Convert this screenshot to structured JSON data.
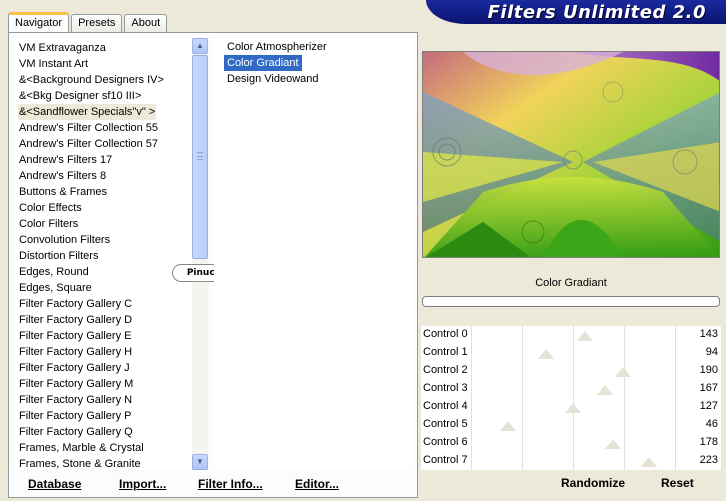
{
  "tabs": [
    {
      "label": "Navigator"
    },
    {
      "label": "Presets"
    },
    {
      "label": "About"
    }
  ],
  "app_title": "Filters Unlimited 2.0",
  "categories": [
    "VM Extravaganza",
    "VM Instant Art",
    "&<Background Designers IV>",
    "&<Bkg Designer sf10 III>",
    "&<Sandflower Specials\"v\" >",
    "Andrew's Filter Collection 55",
    "Andrew's Filter Collection 57",
    "Andrew's Filters 17",
    "Andrew's Filters 8",
    "Buttons & Frames",
    "Color Effects",
    "Color Filters",
    "Convolution Filters",
    "Distortion Filters",
    "Edges, Round",
    "Edges, Square",
    "Filter Factory Gallery C",
    "Filter Factory Gallery D",
    "Filter Factory Gallery E",
    "Filter Factory Gallery H",
    "Filter Factory Gallery J",
    "Filter Factory Gallery M",
    "Filter Factory Gallery N",
    "Filter Factory Gallery P",
    "Filter Factory Gallery Q",
    "Frames, Marble & Crystal",
    "Frames, Stone & Granite"
  ],
  "selected_category_index": 4,
  "filters": [
    "Color Atmospherizer",
    "Color Gradiant",
    "Design Videowand"
  ],
  "selected_filter_index": 1,
  "watermark": "Pinuccia",
  "bottom_buttons": {
    "database": "Database",
    "import": "Import...",
    "filter_info": "Filter Info...",
    "editor": "Editor..."
  },
  "current_filter": "Color Gradiant",
  "controls": [
    {
      "label": "Control 0",
      "value": "143"
    },
    {
      "label": "Control 1",
      "value": "94"
    },
    {
      "label": "Control 2",
      "value": "190"
    },
    {
      "label": "Control 3",
      "value": "167"
    },
    {
      "label": "Control 4",
      "value": "127"
    },
    {
      "label": "Control 5",
      "value": "46"
    },
    {
      "label": "Control 6",
      "value": "178"
    },
    {
      "label": "Control 7",
      "value": "223"
    }
  ],
  "randomize_label": "Randomize",
  "reset_label": "Reset",
  "colors": {
    "selection": "#316ac5",
    "logo_band": "#1a2a9e",
    "window_bg": "#ece9d8"
  }
}
